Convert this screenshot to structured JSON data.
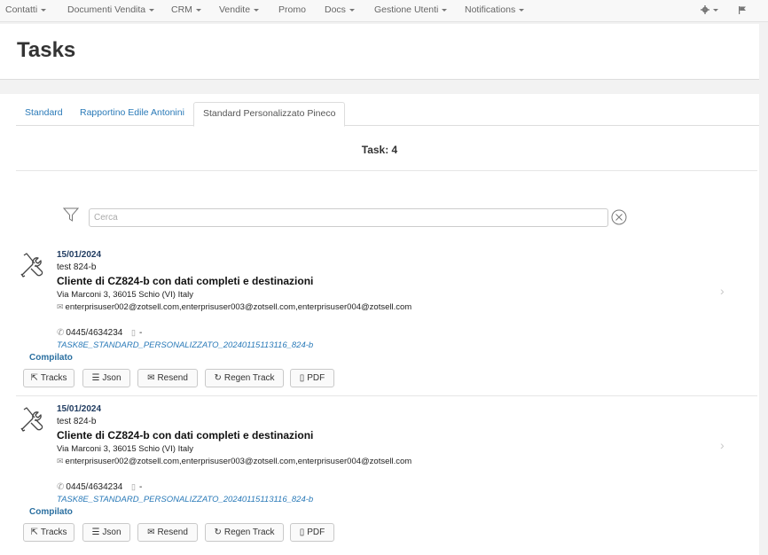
{
  "nav": {
    "items": [
      {
        "label": "Contatti",
        "dropdown": true
      },
      {
        "label": "Documenti Vendita",
        "dropdown": true
      },
      {
        "label": "CRM",
        "dropdown": true
      },
      {
        "label": "Vendite",
        "dropdown": true
      },
      {
        "label": "Promo",
        "dropdown": false
      },
      {
        "label": "Docs",
        "dropdown": true
      },
      {
        "label": "Gestione Utenti",
        "dropdown": true
      },
      {
        "label": "Notifications",
        "dropdown": true
      }
    ],
    "right_icons": [
      "gear-icon",
      "flag-icon"
    ]
  },
  "page": {
    "title": "Tasks"
  },
  "tabs": [
    {
      "label": "Standard",
      "active": false
    },
    {
      "label": "Rapportino Edile Antonini",
      "active": false
    },
    {
      "label": "Standard Personalizzato Pineco",
      "active": true
    }
  ],
  "task_count_label": "Task: 4",
  "search": {
    "placeholder": "Cerca",
    "value": ""
  },
  "tasks": [
    {
      "date": "15/01/2024",
      "code": "test 824-b",
      "client": "Cliente di CZ824-b con dati completi e destinazioni",
      "address": "Via Marconi 3, 36015 Schio (VI) Italy",
      "emails": "enterprisuser002@zotsell.com,enterprisuser003@zotsell.com,enterprisuser004@zotsell.com",
      "phone": "0445/4634234",
      "mobile": "-",
      "reference": "TASK8E_STANDARD_PERSONALIZZATO_20240115113116_824-b",
      "status": "Compilato"
    },
    {
      "date": "15/01/2024",
      "code": "test 824-b",
      "client": "Cliente di CZ824-b con dati completi e destinazioni",
      "address": "Via Marconi 3, 36015 Schio (VI) Italy",
      "emails": "enterprisuser002@zotsell.com,enterprisuser003@zotsell.com,enterprisuser004@zotsell.com",
      "phone": "0445/4634234",
      "mobile": "-",
      "reference": "TASK8E_STANDARD_PERSONALIZZATO_20240115113116_824-b",
      "status": "Compilato"
    }
  ],
  "actions": {
    "tracks": "Tracks",
    "json": "Json",
    "resend": "Resend",
    "regen": "Regen Track",
    "pdf": "PDF"
  },
  "colors": {
    "link": "#2a7ab8",
    "status": "#2a6fa0",
    "date": "#1e3a5f"
  }
}
